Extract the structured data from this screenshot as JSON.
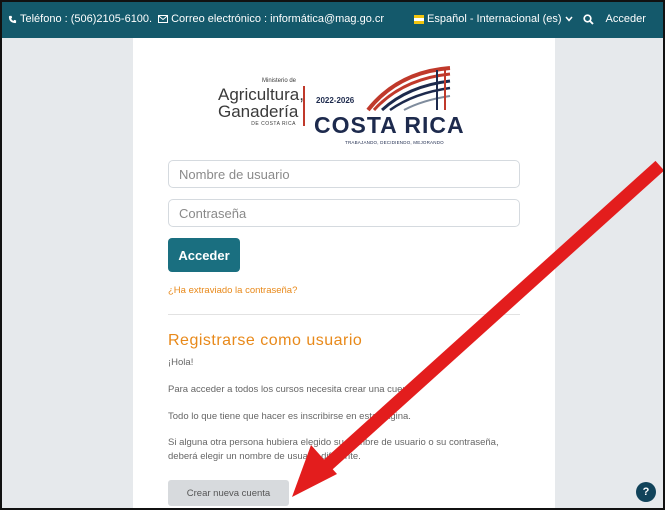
{
  "topbar": {
    "phone": "Teléfono : (506)2105-6100.",
    "email": "Correo electrónico : informática@mag.go.cr",
    "language": "Español - Internacional (es)",
    "login": "Acceder"
  },
  "logo": {
    "ministerio": "Ministerio de",
    "agricultura": "Agricultura,",
    "ganaderia": "Ganadería",
    "de_costa_rica": "DE COSTA RICA",
    "years": "2022-2026",
    "country": "COSTA RICA",
    "slogan": "TRABAJANDO, DECIDIENDO, MEJORANDO"
  },
  "form": {
    "username_placeholder": "Nombre de usuario",
    "password_placeholder": "Contraseña",
    "login_button": "Acceder",
    "forgot_link": "¿Ha extraviado la contraseña?"
  },
  "register": {
    "title": "Registrarse como usuario",
    "paragraphs": [
      "¡Hola!",
      "Para acceder a todos los cursos necesita crear una cuenta.",
      "Todo lo que tiene que hacer es inscribirse en esta página.",
      "Si alguna otra persona hubiera elegido su nombre de usuario o su contraseña, deberá elegir un nombre de usuario diferente."
    ],
    "create_button": "Crear nueva cuenta"
  },
  "help": {
    "label": "?"
  },
  "colors": {
    "topbar": "#14596b",
    "primary_button": "#1a6f80",
    "accent_orange": "#e8891a",
    "arrow_red": "#e31d1d",
    "background": "#e6e9ec"
  },
  "icons": [
    "phone-icon",
    "mail-icon",
    "flag-icon",
    "chevron-down-icon",
    "search-icon",
    "help-icon",
    "annotation-arrow"
  ]
}
